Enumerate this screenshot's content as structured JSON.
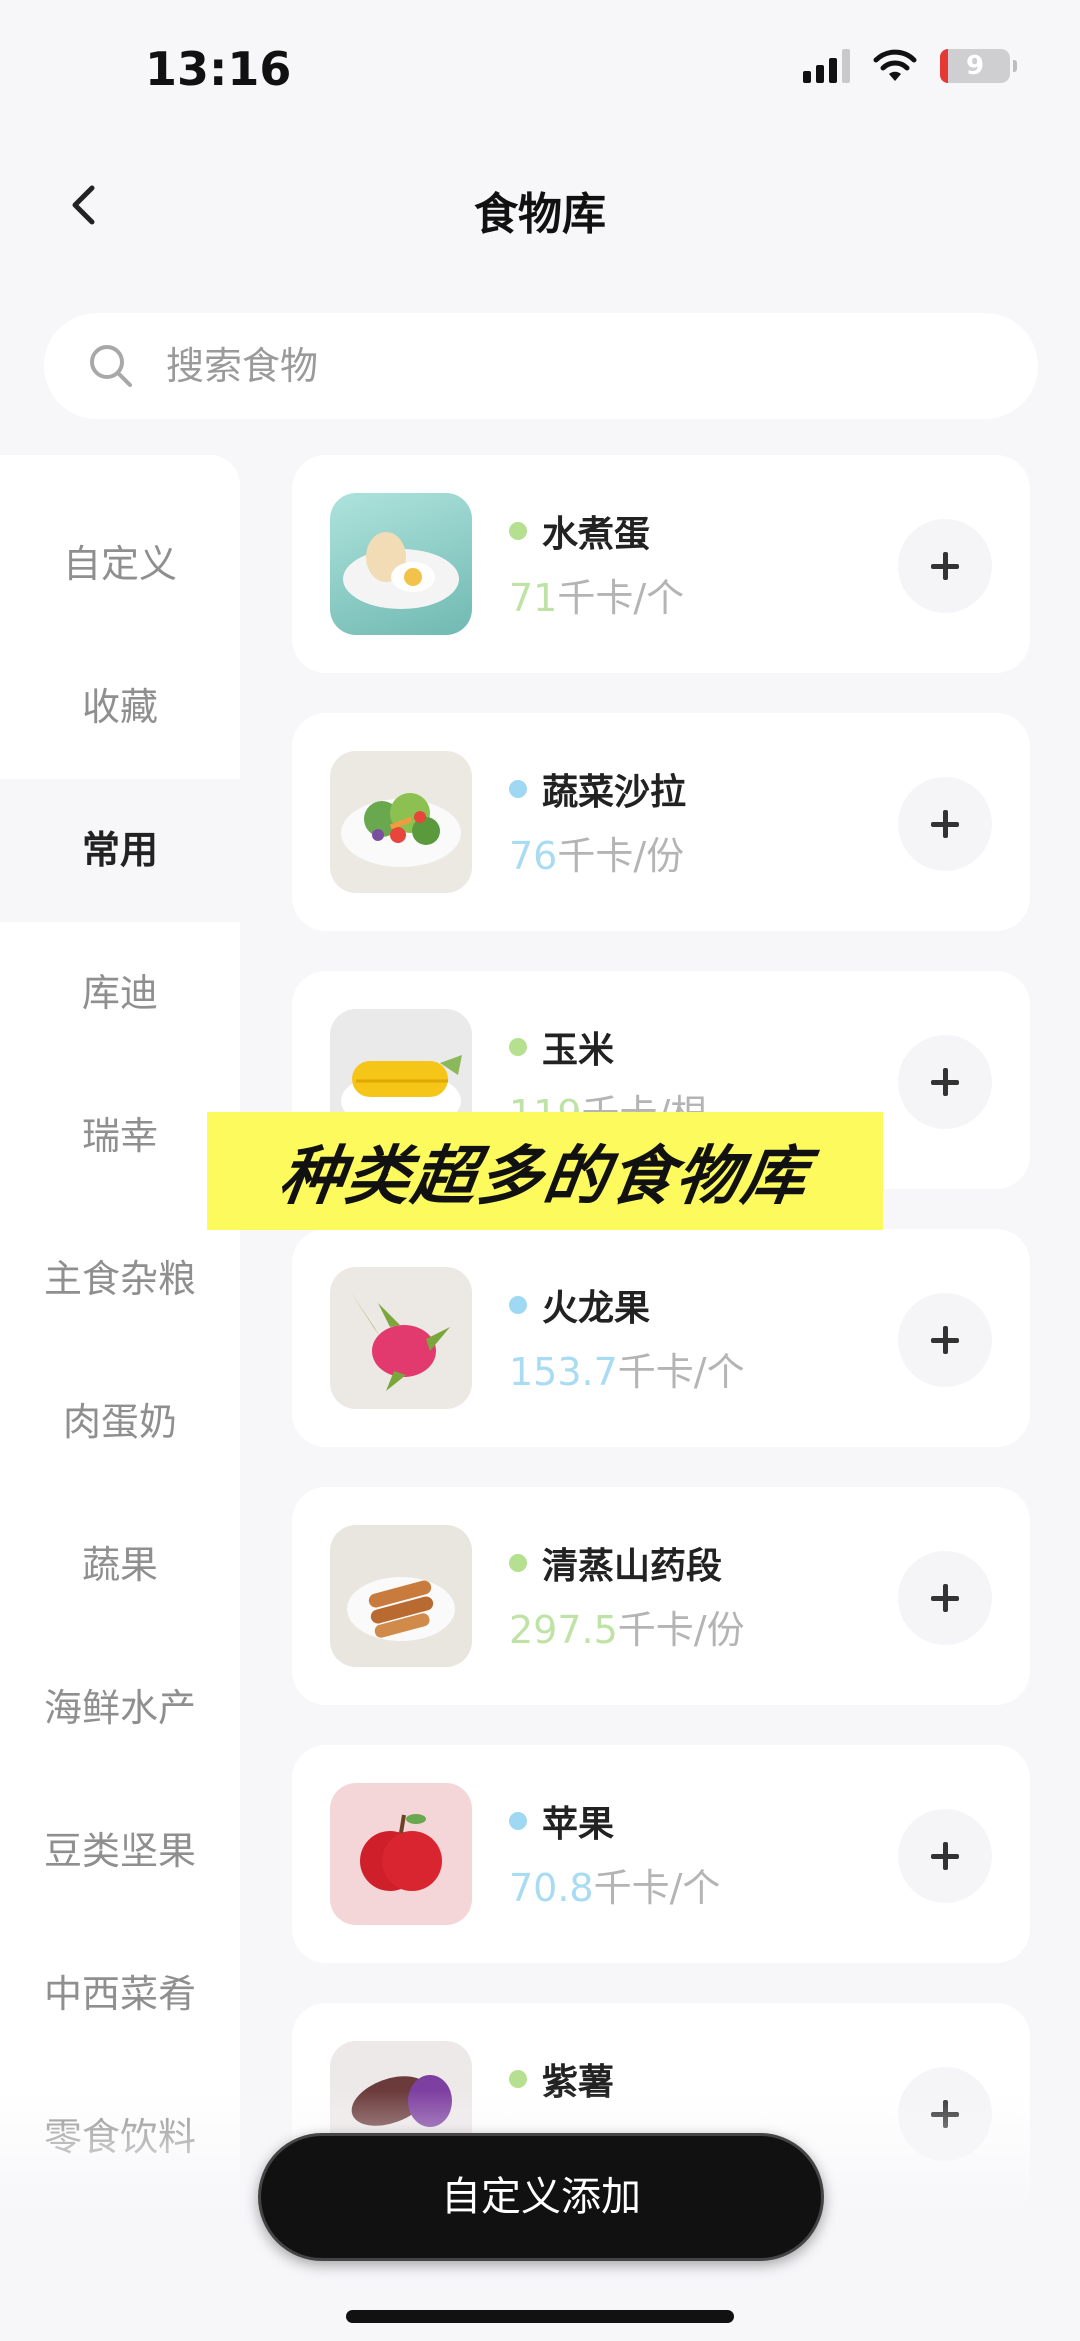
{
  "status_bar": {
    "time": "13:16",
    "battery": "9"
  },
  "nav": {
    "title": "食物库"
  },
  "search": {
    "placeholder": "搜索食物"
  },
  "sidebar": {
    "items": [
      {
        "label": "自定义"
      },
      {
        "label": "收藏"
      },
      {
        "label": "常用",
        "active": true
      },
      {
        "label": "库迪"
      },
      {
        "label": "瑞幸"
      },
      {
        "label": "主食杂粮"
      },
      {
        "label": "肉蛋奶"
      },
      {
        "label": "蔬果"
      },
      {
        "label": "海鲜水产"
      },
      {
        "label": "豆类坚果"
      },
      {
        "label": "中西菜肴"
      },
      {
        "label": "零食饮料"
      }
    ]
  },
  "foods": [
    {
      "name": "水煮蛋",
      "kcal": "71",
      "unit": "千卡/个",
      "dot_color": "#b4e08f",
      "kcal_color": "#bfe3a6"
    },
    {
      "name": "蔬菜沙拉",
      "kcal": "76",
      "unit": "千卡/份",
      "dot_color": "#9fd8f2",
      "kcal_color": "#a9dcf2"
    },
    {
      "name": "玉米",
      "kcal": "119",
      "unit": "千卡/根",
      "dot_color": "#b4e08f",
      "kcal_color": "#bfe3a6"
    },
    {
      "name": "火龙果",
      "kcal": "153.7",
      "unit": "千卡/个",
      "dot_color": "#9fd8f2",
      "kcal_color": "#a9dcf2"
    },
    {
      "name": "清蒸山药段",
      "kcal": "297.5",
      "unit": "千卡/份",
      "dot_color": "#b4e08f",
      "kcal_color": "#bfe3a6"
    },
    {
      "name": "苹果",
      "kcal": "70.8",
      "unit": "千卡/个",
      "dot_color": "#9fd8f2",
      "kcal_color": "#a9dcf2"
    },
    {
      "name": "紫薯",
      "kcal": "",
      "unit": "",
      "dot_color": "#b4e08f",
      "kcal_color": "#bfe3a6"
    }
  ],
  "banner": {
    "text": "种类超多的食物库"
  },
  "bottom": {
    "button_label": "自定义添加"
  }
}
